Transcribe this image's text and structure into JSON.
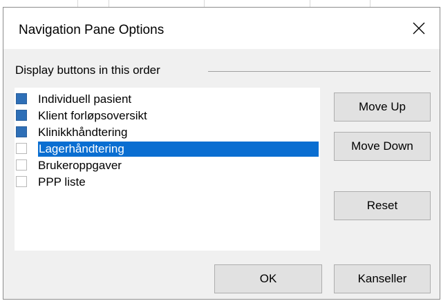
{
  "dialog": {
    "title": "Navigation Pane Options",
    "group_label": "Display buttons in this order"
  },
  "list": {
    "items": [
      {
        "label": "Individuell pasient",
        "checked": true,
        "selected": false
      },
      {
        "label": "Klient forløpsoversikt",
        "checked": true,
        "selected": false
      },
      {
        "label": "Klinikkhåndtering",
        "checked": true,
        "selected": false
      },
      {
        "label": "Lagerhåndtering",
        "checked": false,
        "selected": true
      },
      {
        "label": "Brukeroppgaver",
        "checked": false,
        "selected": false
      },
      {
        "label": "PPP liste",
        "checked": false,
        "selected": false
      }
    ]
  },
  "buttons": {
    "move_up": "Move Up",
    "move_down": "Move Down",
    "reset": "Reset",
    "ok": "OK",
    "cancel": "Kanseller"
  },
  "colors": {
    "checked_fill": "#2e6fb7",
    "selection": "#0a6ed1"
  }
}
